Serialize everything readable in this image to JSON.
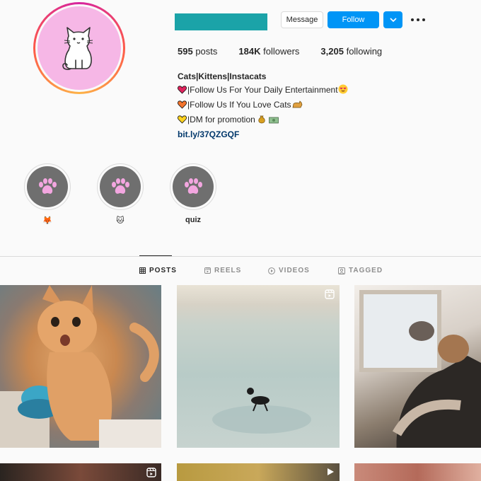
{
  "profile": {
    "stats": [
      {
        "count": "595",
        "label": "posts"
      },
      {
        "count": "184K",
        "label": "followers"
      },
      {
        "count": "3,205",
        "label": "following"
      }
    ],
    "bio": {
      "name": "Cats|Kittens|Instacats",
      "line1": "|Follow Us For Your Daily Entertainment",
      "line2": "|Follow Us If You Love Cats",
      "line3": "|DM for promotion",
      "link": "bit.ly/37QZGQF"
    }
  },
  "actions": {
    "message_label": "Message",
    "follow_label": "Follow"
  },
  "highlights": [
    {
      "label": "🦊"
    },
    {
      "label": "🐱"
    },
    {
      "label": "quiz"
    }
  ],
  "tabs": [
    {
      "label": "POSTS",
      "icon": "grid-icon",
      "active": true
    },
    {
      "label": "REELS",
      "icon": "reels-icon",
      "active": false
    },
    {
      "label": "VIDEOS",
      "icon": "play-circle-icon",
      "active": false
    },
    {
      "label": "TAGGED",
      "icon": "tag-icon",
      "active": false
    }
  ],
  "colors": {
    "accent": "#0095f6",
    "username_block": "#1ba3a8",
    "avatar_bg": "#f6b7e6",
    "highlight_bg": "#6f6f6f"
  }
}
